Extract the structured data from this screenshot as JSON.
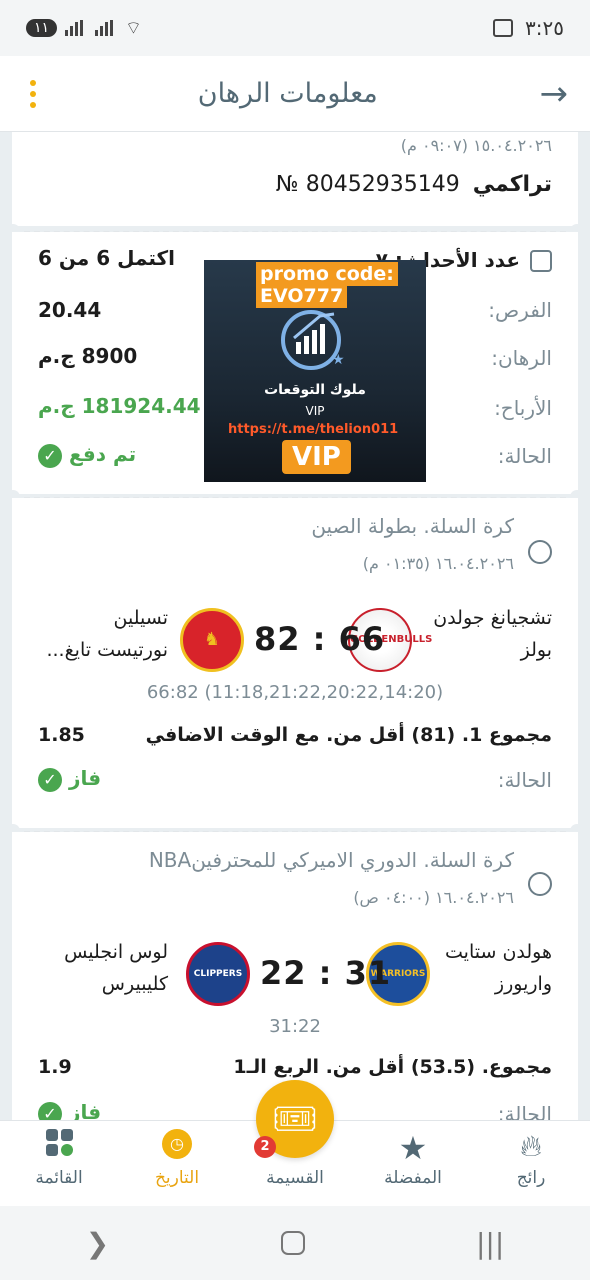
{
  "status_bar": {
    "time": "٣:٢٥",
    "notif_count": "١١"
  },
  "header": {
    "title": "معلومات الرهان"
  },
  "bet": {
    "date": "١٥.٠٤.٢٠٢٦ (٠٩:٠٧ م)",
    "type": "تراكمي",
    "number": "80452935149 №",
    "events_label": "عدد الأحداث: ٧",
    "completed": "اكتمل 6 من 6",
    "odds_label": "الفرص:",
    "odds_value": "20.44",
    "stake_label": "الرهان:",
    "stake_value": "8900 ج.م",
    "winnings_label": "الأرباح:",
    "winnings_value": "181924.44 ج.م",
    "status_label": "الحالة:",
    "status_value": "تم دفع"
  },
  "promo": {
    "line1": "promo code:",
    "line2": "EVO777",
    "brand": "ملوك التوقعات",
    "vip_small": "VIP",
    "link": "https://t.me/thelion011",
    "vip_big": "VIP"
  },
  "events": [
    {
      "league": "كرة السلة. بطولة الصين",
      "date": "١٦.٠٤.٢٠٢٦ (٠١:٣٥ م)",
      "home_line1": "تشجيانغ جولدن",
      "home_line2": "بولز",
      "away_line1": "تسيلين",
      "away_line2": "نورتيست تايغ...",
      "score": "82 : 66",
      "periods": "66:82 (11:18,21:22,20:22,14:20)",
      "market": "مجموع 1. (81) أقل من. مع الوقت الاضافي",
      "odds": "1.85",
      "status_label": "الحالة:",
      "status_value": "فاز"
    },
    {
      "league": "كرة السلة. الدوري الاميركي للمحترفينNBA",
      "date": "١٦.٠٤.٢٠٢٦ (٠٤:٠٠ ص)",
      "home_line1": "هولدن ستايت",
      "home_line2": "واريورز",
      "away_line1": "لوس انجليس",
      "away_line2": "كليبيرس",
      "score": "22 : 31",
      "periods": "31:22",
      "market": "مجموع. (53.5) أقل من. الربع الـ1",
      "odds": "1.9",
      "status_label": "الحالة:",
      "status_value": "فاز"
    }
  ],
  "nav": {
    "items": [
      {
        "label": "رائج",
        "icon": "fire-icon"
      },
      {
        "label": "المفضلة",
        "icon": "star-icon"
      },
      {
        "label": "القسيمة",
        "icon": "ticket-icon"
      },
      {
        "label": "التاريخ",
        "icon": "clock-icon"
      },
      {
        "label": "القائمة",
        "icon": "grid-icon"
      }
    ],
    "badge": "2"
  },
  "colors": {
    "accent": "#f2b20e",
    "green": "#4aa64f",
    "muted": "#7d8c95"
  }
}
